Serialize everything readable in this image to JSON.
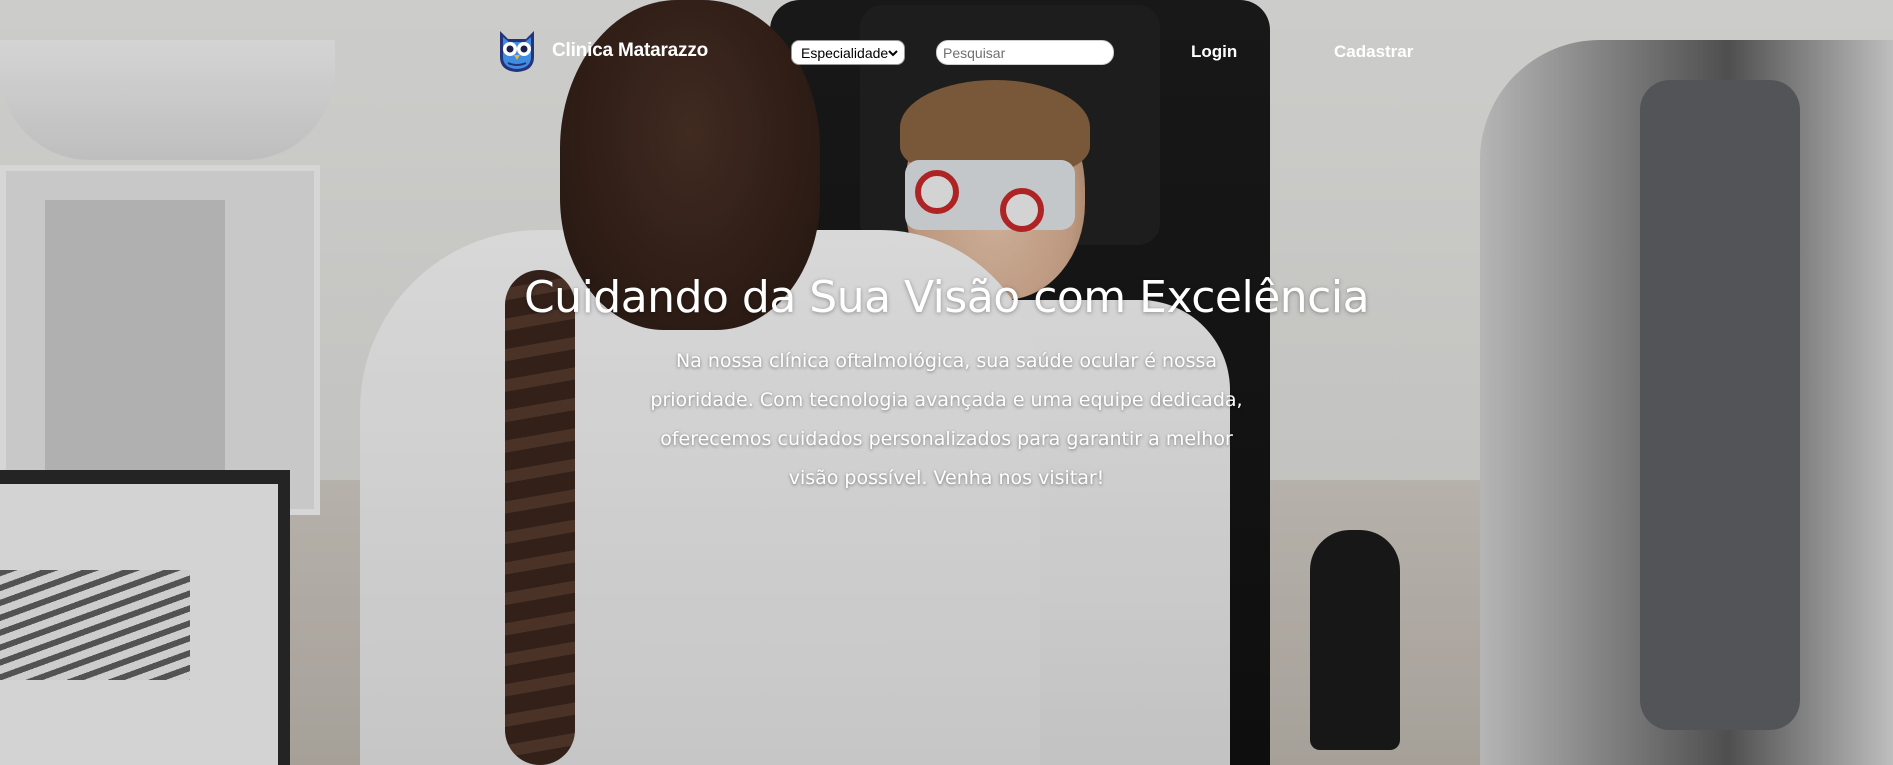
{
  "navbar": {
    "brand_name": "Clinica Matarazzo",
    "logo_icon": "owl-logo-icon",
    "specialty_select": {
      "selected": "Especialidade"
    },
    "search": {
      "placeholder": "Pesquisar",
      "value": ""
    },
    "login_label": "Login",
    "register_label": "Cadastrar"
  },
  "hero": {
    "headline": "Cuidando da Sua Visão com Excelência",
    "description_lines": [
      "Na nossa clínica oftalmológica, sua saúde ocular é nossa",
      "prioridade. Com tecnologia avançada e uma equipe dedicada,",
      "oferecemos cuidados personalizados para garantir a melhor",
      "visão possível. Venha nos visitar!"
    ]
  },
  "colors": {
    "text": "#ffffff",
    "logo_blue": "#3f8de0",
    "logo_dark": "#26327a"
  }
}
